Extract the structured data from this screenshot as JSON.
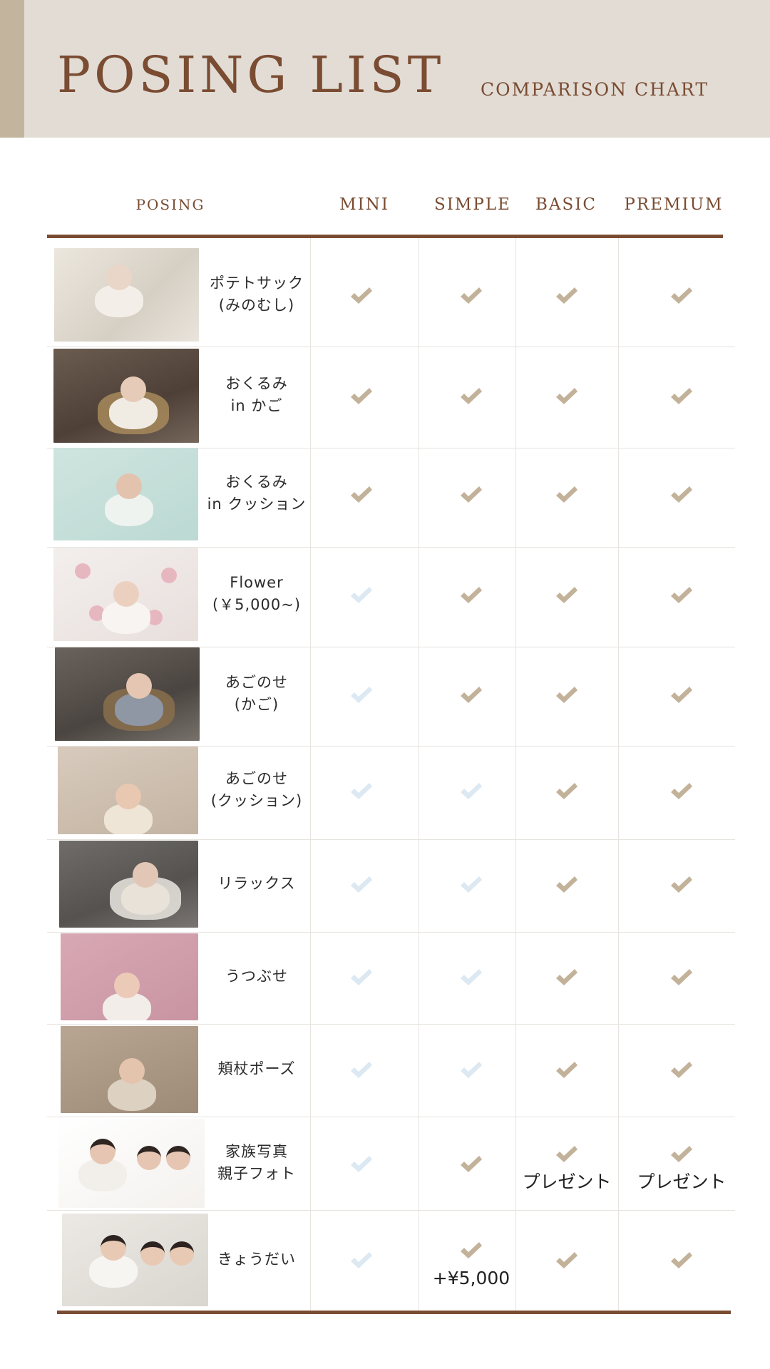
{
  "header": {
    "title": "POSING LIST",
    "subtitle": "COMPARISON CHART"
  },
  "columns": {
    "posing": "POSING",
    "mini": "MINI",
    "simple": "SIMPLE",
    "basic": "BASIC",
    "premium": "PREMIUM"
  },
  "colors": {
    "included": "#c3b29a",
    "not_included": "#dce8f2",
    "accent": "#7a4c32",
    "header_bg": "#e2dcd5"
  },
  "icons": {
    "included": "check-icon",
    "not_included": "check-icon-faded"
  },
  "rows": [
    {
      "line1": "ポテトサック",
      "line2": "(みのむし)",
      "photo": "baby-on-fur-photo",
      "mini": true,
      "simple": true,
      "basic": true,
      "premium": true
    },
    {
      "line1": "おくるみ",
      "line2": "in かご",
      "photo": "baby-in-basket-photo",
      "mini": true,
      "simple": true,
      "basic": true,
      "premium": true
    },
    {
      "line1": "おくるみ",
      "line2": "in クッション",
      "photo": "baby-on-mint-photo",
      "mini": true,
      "simple": true,
      "basic": true,
      "premium": true
    },
    {
      "line1": "Flower",
      "line2": "(￥5,000~)",
      "photo": "baby-bunny-flower-photo",
      "mini": false,
      "simple": true,
      "basic": true,
      "premium": true
    },
    {
      "line1": "あごのせ",
      "line2": "(かご)",
      "photo": "baby-in-bucket-photo",
      "mini": false,
      "simple": true,
      "basic": true,
      "premium": true
    },
    {
      "line1": "あごのせ",
      "line2": "(クッション)",
      "photo": "baby-bonnet-photo",
      "mini": false,
      "simple": false,
      "basic": true,
      "premium": true
    },
    {
      "line1": "リラックス",
      "line2": "",
      "photo": "baby-in-crate-photo",
      "mini": false,
      "simple": false,
      "basic": true,
      "premium": true
    },
    {
      "line1": "うつぶせ",
      "line2": "",
      "photo": "baby-on-pink-photo",
      "mini": false,
      "simple": false,
      "basic": true,
      "premium": true
    },
    {
      "line1": "頬杖ポーズ",
      "line2": "",
      "photo": "baby-chin-pose-photo",
      "mini": false,
      "simple": false,
      "basic": true,
      "premium": true
    },
    {
      "line1": "家族写真",
      "line2": "親子フォト",
      "photo": "family-photo",
      "mini": false,
      "simple": true,
      "basic": true,
      "premium": true,
      "basic_note": "プレゼント",
      "premium_note": "プレゼント"
    },
    {
      "line1": "きょうだい",
      "line2": "",
      "photo": "siblings-photo",
      "mini": false,
      "simple": true,
      "basic": true,
      "premium": true,
      "simple_note": "+¥5,000"
    }
  ]
}
